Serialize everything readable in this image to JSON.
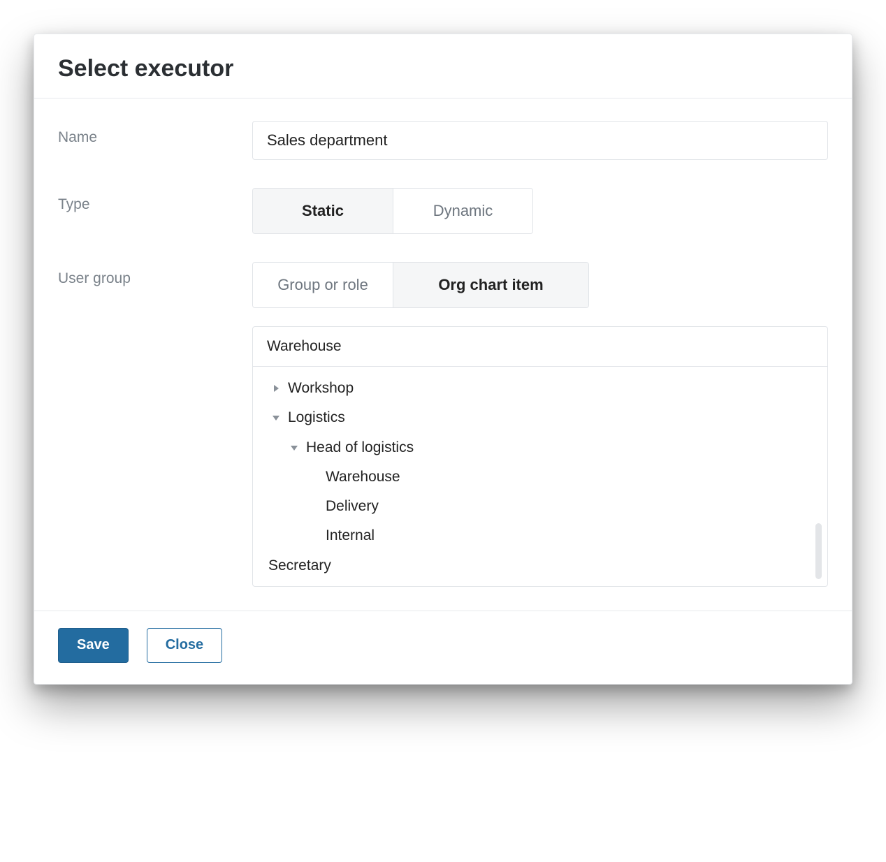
{
  "dialog": {
    "title": "Select executor"
  },
  "form": {
    "name": {
      "label": "Name",
      "value": "Sales department"
    },
    "type": {
      "label": "Type",
      "options": [
        "Static",
        "Dynamic"
      ],
      "selected": "Static"
    },
    "user_group": {
      "label": "User group",
      "options": [
        "Group or role",
        "Org chart item"
      ],
      "selected": "Org chart item"
    }
  },
  "tree": {
    "breadcrumb": "Warehouse",
    "items": [
      {
        "label": "Workshop",
        "level": 0,
        "icon": "caret-right"
      },
      {
        "label": "Logistics",
        "level": 0,
        "icon": "caret-down"
      },
      {
        "label": "Head of logistics",
        "level": 1,
        "icon": "caret-down"
      },
      {
        "label": "Warehouse",
        "level": 2,
        "icon": "none"
      },
      {
        "label": "Delivery",
        "level": 2,
        "icon": "none"
      },
      {
        "label": "Internal",
        "level": 2,
        "icon": "none"
      },
      {
        "label": "Secretary",
        "level": 0,
        "icon": "none"
      }
    ]
  },
  "footer": {
    "save": "Save",
    "close": "Close"
  }
}
